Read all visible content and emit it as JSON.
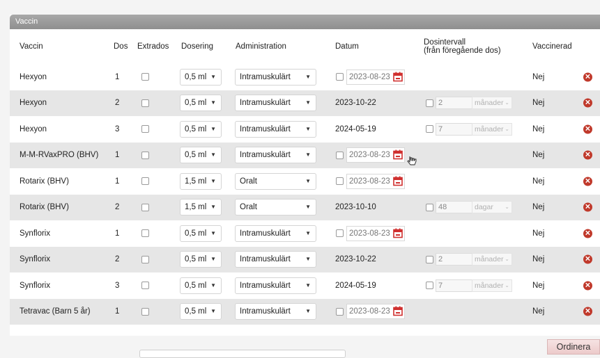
{
  "panel": {
    "title": "Vaccin"
  },
  "columns": {
    "vaccin": "Vaccin",
    "dos": "Dos",
    "extrados": "Extrados",
    "dosering": "Dosering",
    "administration": "Administration",
    "datum": "Datum",
    "dosintervall_line1": "Dosintervall",
    "dosintervall_line2": "(från föregående dos)",
    "vaccinerad": "Vaccinerad"
  },
  "rows": [
    {
      "vaccin": "Hexyon",
      "dos": "1",
      "dosering": "0,5 ml",
      "administration": "Intramuskulärt",
      "datum": "2023-08-23",
      "interval_value": "",
      "interval_unit": "",
      "vaccinerad": "Nej"
    },
    {
      "vaccin": "Hexyon",
      "dos": "2",
      "dosering": "0,5 ml",
      "administration": "Intramuskulärt",
      "datum": "2023-10-22",
      "interval_value": "2",
      "interval_unit": "månader",
      "vaccinerad": "Nej"
    },
    {
      "vaccin": "Hexyon",
      "dos": "3",
      "dosering": "0,5 ml",
      "administration": "Intramuskulärt",
      "datum": "2024-05-19",
      "interval_value": "7",
      "interval_unit": "månader",
      "vaccinerad": "Nej"
    },
    {
      "vaccin": "M-M-RVaxPRO (BHV)",
      "dos": "1",
      "dosering": "0,5 ml",
      "administration": "Intramuskulärt",
      "datum": "2023-08-23",
      "interval_value": "",
      "interval_unit": "",
      "vaccinerad": "Nej"
    },
    {
      "vaccin": "Rotarix (BHV)",
      "dos": "1",
      "dosering": "1,5 ml",
      "administration": "Oralt",
      "datum": "2023-08-23",
      "interval_value": "",
      "interval_unit": "",
      "vaccinerad": "Nej"
    },
    {
      "vaccin": "Rotarix (BHV)",
      "dos": "2",
      "dosering": "1,5 ml",
      "administration": "Oralt",
      "datum": "2023-10-10",
      "interval_value": "48",
      "interval_unit": "dagar",
      "vaccinerad": "Nej"
    },
    {
      "vaccin": "Synflorix",
      "dos": "1",
      "dosering": "0,5 ml",
      "administration": "Intramuskulärt",
      "datum": "2023-08-23",
      "interval_value": "",
      "interval_unit": "",
      "vaccinerad": "Nej"
    },
    {
      "vaccin": "Synflorix",
      "dos": "2",
      "dosering": "0,5 ml",
      "administration": "Intramuskulärt",
      "datum": "2023-10-22",
      "interval_value": "2",
      "interval_unit": "månader",
      "vaccinerad": "Nej"
    },
    {
      "vaccin": "Synflorix",
      "dos": "3",
      "dosering": "0,5 ml",
      "administration": "Intramuskulärt",
      "datum": "2024-05-19",
      "interval_value": "7",
      "interval_unit": "månader",
      "vaccinerad": "Nej"
    },
    {
      "vaccin": "Tetravac (Barn 5 år)",
      "dos": "1",
      "dosering": "0,5 ml",
      "administration": "Intramuskulärt",
      "datum": "2023-08-23",
      "interval_value": "",
      "interval_unit": "",
      "vaccinerad": "Nej"
    }
  ],
  "actions": {
    "order_label": "Ordinera"
  },
  "colors": {
    "delete": "#c0392b",
    "calendar": "#d0302f",
    "header_bar": "#9a9a9a",
    "stripe": "#e6e6e6",
    "order_button": "#eccaca"
  }
}
